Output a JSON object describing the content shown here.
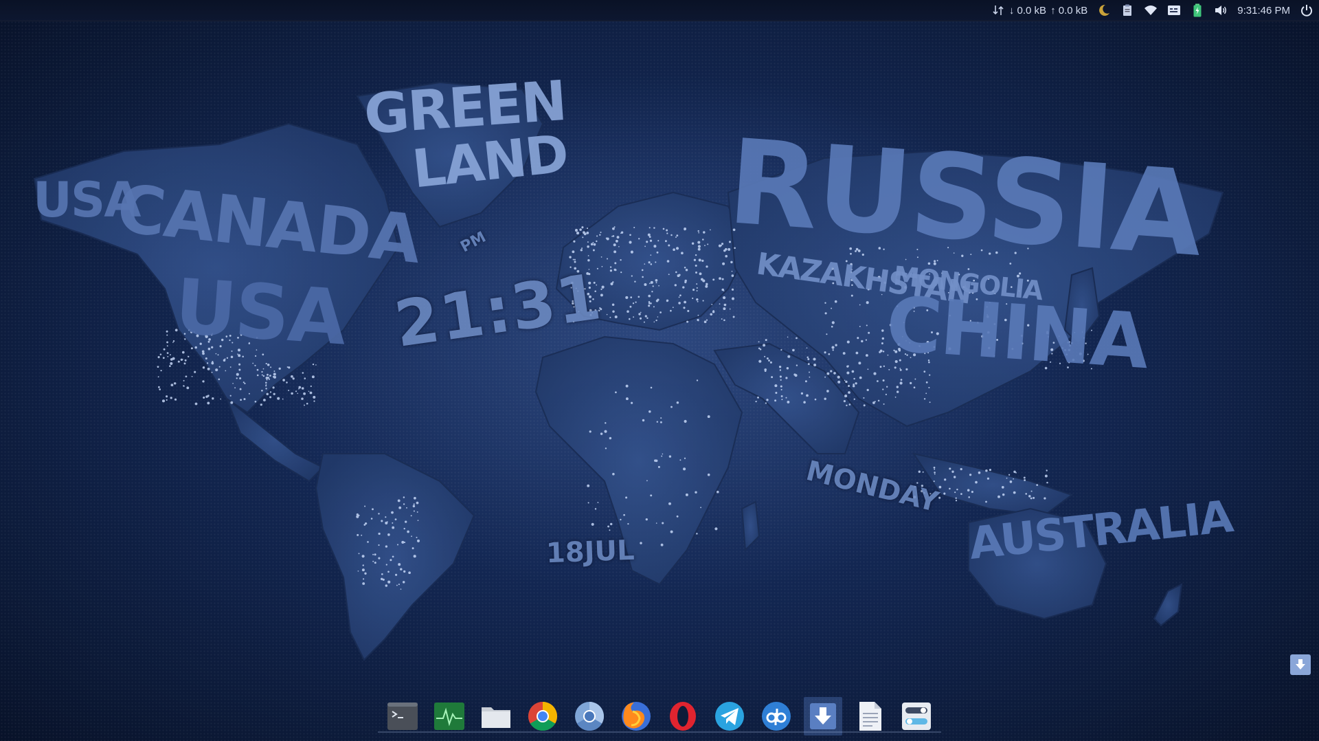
{
  "top_panel": {
    "net_down": "↓ 0.0 kB",
    "net_up": "↑ 0.0 kB",
    "clock": "9:31:46 PM",
    "tray_icons": [
      "network-transfer-icon",
      "weather-moon-icon",
      "clipboard-icon",
      "wifi-icon",
      "keyboard-icon",
      "battery-icon",
      "volume-icon",
      "power-icon"
    ]
  },
  "wallpaper": {
    "clock_time": "21:31",
    "clock_ampm": "PM",
    "clock_day": "MONDAY",
    "clock_date": "18JUL",
    "countries": [
      "GREEN",
      "LAND",
      "USA",
      "CANADA",
      "USA",
      "RUSSIA",
      "KAZAKHSTAN",
      "MONGOLIA",
      "CHINA",
      "AUSTRALIA"
    ]
  },
  "dock": {
    "items": [
      {
        "name": "terminal",
        "icon": "terminal-icon"
      },
      {
        "name": "system-monitor",
        "icon": "system-monitor-icon"
      },
      {
        "name": "files",
        "icon": "folder-icon"
      },
      {
        "name": "chrome",
        "icon": "chrome-icon"
      },
      {
        "name": "chromium",
        "icon": "chromium-icon"
      },
      {
        "name": "firefox",
        "icon": "firefox-icon"
      },
      {
        "name": "opera",
        "icon": "opera-icon"
      },
      {
        "name": "telegram",
        "icon": "telegram-icon"
      },
      {
        "name": "qbittorrent",
        "icon": "qbittorrent-icon"
      },
      {
        "name": "downloader",
        "icon": "download-arrow-icon"
      },
      {
        "name": "text-editor",
        "icon": "document-icon"
      },
      {
        "name": "settings",
        "icon": "settings-toggle-icon"
      }
    ]
  },
  "colors": {
    "background": "#132754",
    "map_land": "#2a4478",
    "map_text": "#4c6aa7",
    "city_lights": "#cfe0ff",
    "clock_text": "#6f8dc5"
  }
}
